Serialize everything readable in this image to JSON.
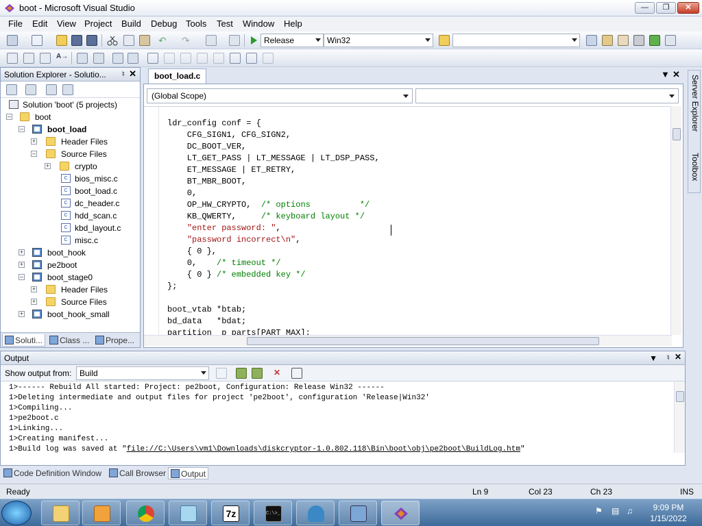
{
  "window": {
    "title": "boot - Microsoft Visual Studio"
  },
  "menu": [
    "File",
    "Edit",
    "View",
    "Project",
    "Build",
    "Debug",
    "Tools",
    "Test",
    "Window",
    "Help"
  ],
  "toolbar": {
    "configuration": "Release",
    "platform": "Win32",
    "find_box": ""
  },
  "solution_explorer": {
    "title": "Solution Explorer - Solutio...",
    "tree": [
      {
        "label": "Solution 'boot' (5 projects)",
        "kind": "sol"
      },
      {
        "label": "boot",
        "kind": "folder"
      },
      {
        "label": "boot_load",
        "kind": "proj"
      },
      {
        "label": "Header Files",
        "kind": "folder"
      },
      {
        "label": "Source Files",
        "kind": "folder"
      },
      {
        "label": "crypto",
        "kind": "folder"
      },
      {
        "label": "bios_misc.c",
        "kind": "cfile"
      },
      {
        "label": "boot_load.c",
        "kind": "cfile"
      },
      {
        "label": "dc_header.c",
        "kind": "cfile"
      },
      {
        "label": "hdd_scan.c",
        "kind": "cfile"
      },
      {
        "label": "kbd_layout.c",
        "kind": "cfile"
      },
      {
        "label": "misc.c",
        "kind": "cfile"
      },
      {
        "label": "boot_hook",
        "kind": "proj"
      },
      {
        "label": "pe2boot",
        "kind": "proj"
      },
      {
        "label": "boot_stage0",
        "kind": "proj"
      },
      {
        "label": "Header Files",
        "kind": "folder"
      },
      {
        "label": "Source Files",
        "kind": "folder"
      },
      {
        "label": "boot_hook_small",
        "kind": "proj"
      }
    ],
    "tabs": [
      "Soluti...",
      "Class ...",
      "Prope..."
    ]
  },
  "editor": {
    "tab": "boot_load.c",
    "scope": "(Global Scope)",
    "member": "",
    "lines": [
      {
        "code": "ldr_config conf = {"
      },
      {
        "code": "    CFG_SIGN1, CFG_SIGN2,"
      },
      {
        "code": "    DC_BOOT_VER,"
      },
      {
        "code": "    LT_GET_PASS | LT_MESSAGE | LT_DSP_PASS,"
      },
      {
        "code": "    ET_MESSAGE | ET_RETRY,"
      },
      {
        "code": "    BT_MBR_BOOT,"
      },
      {
        "code": "    0,"
      },
      {
        "code": "    OP_HW_CRYPTO,  ",
        "comment": "/* options          */"
      },
      {
        "code": "    KB_QWERTY,     ",
        "comment": "/* keyboard layout */"
      },
      {
        "code": "    ",
        "string": "\"enter password: \"",
        "tail": ","
      },
      {
        "code": "    ",
        "string": "\"password incorrect\\n\"",
        "tail": ","
      },
      {
        "code": "    { 0 },"
      },
      {
        "code": "    0,    ",
        "comment": "/* timeout */"
      },
      {
        "code": "    { 0 } ",
        "comment": "/* embedded key */"
      },
      {
        "code": "};"
      },
      {
        "code": ""
      },
      {
        "code": "boot_vtab *btab;"
      },
      {
        "code": "bd_data   *bdat;"
      },
      {
        "code": "partition  p_parts[PART_MAX];"
      }
    ]
  },
  "side_tabs": [
    "Server Explorer",
    "Toolbox"
  ],
  "output": {
    "title": "Output",
    "show_from_label": "Show output from:",
    "show_from_value": "Build",
    "lines": [
      "1>------ Rebuild All started: Project: pe2boot, Configuration: Release Win32 ------",
      "1>Deleting intermediate and output files for project 'pe2boot', configuration 'Release|Win32'",
      "1>Compiling...",
      "1>pe2boot.c",
      "1>Linking...",
      "1>Creating manifest..."
    ],
    "buildlog_prefix": "1>Build log was saved at \"",
    "buildlog_link": "file://C:\\Users\\vm1\\Downloads\\diskcryptor-1.0.802.118\\Bin\\boot\\obj\\pe2boot\\BuildLog.htm",
    "buildlog_suffix": "\"",
    "tabs": [
      "Code Definition Window",
      "Call Browser",
      "Output"
    ]
  },
  "status": {
    "text": "Ready",
    "ln": "Ln 9",
    "col": "Col 23",
    "ch": "Ch 23",
    "mode": "INS"
  },
  "taskbar": {
    "apps": [
      "explorer",
      "media-player",
      "chrome",
      "notepad",
      "7z",
      "cmd",
      "wireshark",
      "network",
      "visual-studio"
    ],
    "sevenzip_label": "7z",
    "cmd_label": "C:\\>_",
    "time": "9:09 PM",
    "date": "1/15/2022"
  }
}
